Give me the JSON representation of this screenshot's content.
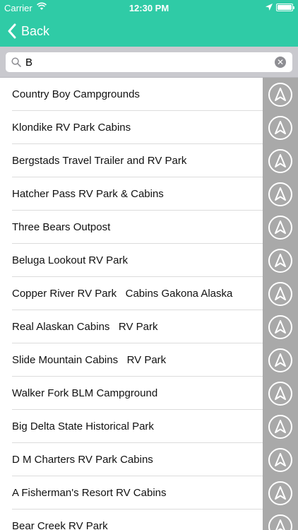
{
  "status": {
    "carrier": "Carrier",
    "time": "12:30 PM"
  },
  "nav": {
    "back_label": "Back"
  },
  "search": {
    "value": "B"
  },
  "colors": {
    "accent": "#2fcba6",
    "nav_button_bg": "#a9a9a9"
  },
  "icons": {
    "navigate": "navigation-arrow-icon"
  },
  "results": [
    {
      "label": "Country Boy Campgrounds"
    },
    {
      "label": "Klondike RV Park Cabins"
    },
    {
      "label": "Bergstads Travel Trailer and RV Park"
    },
    {
      "label": "Hatcher Pass RV Park & Cabins"
    },
    {
      "label": "Three Bears Outpost"
    },
    {
      "label": "Beluga Lookout RV Park"
    },
    {
      "label": "Copper River RV Park   Cabins Gakona Alaska"
    },
    {
      "label": "Real Alaskan Cabins   RV Park"
    },
    {
      "label": "Slide Mountain Cabins   RV Park"
    },
    {
      "label": "Walker Fork BLM Campground"
    },
    {
      "label": "Big Delta State Historical Park"
    },
    {
      "label": "D M Charters RV Park Cabins"
    },
    {
      "label": "A Fisherman's Resort RV Cabins"
    },
    {
      "label": "Bear Creek RV Park"
    }
  ]
}
